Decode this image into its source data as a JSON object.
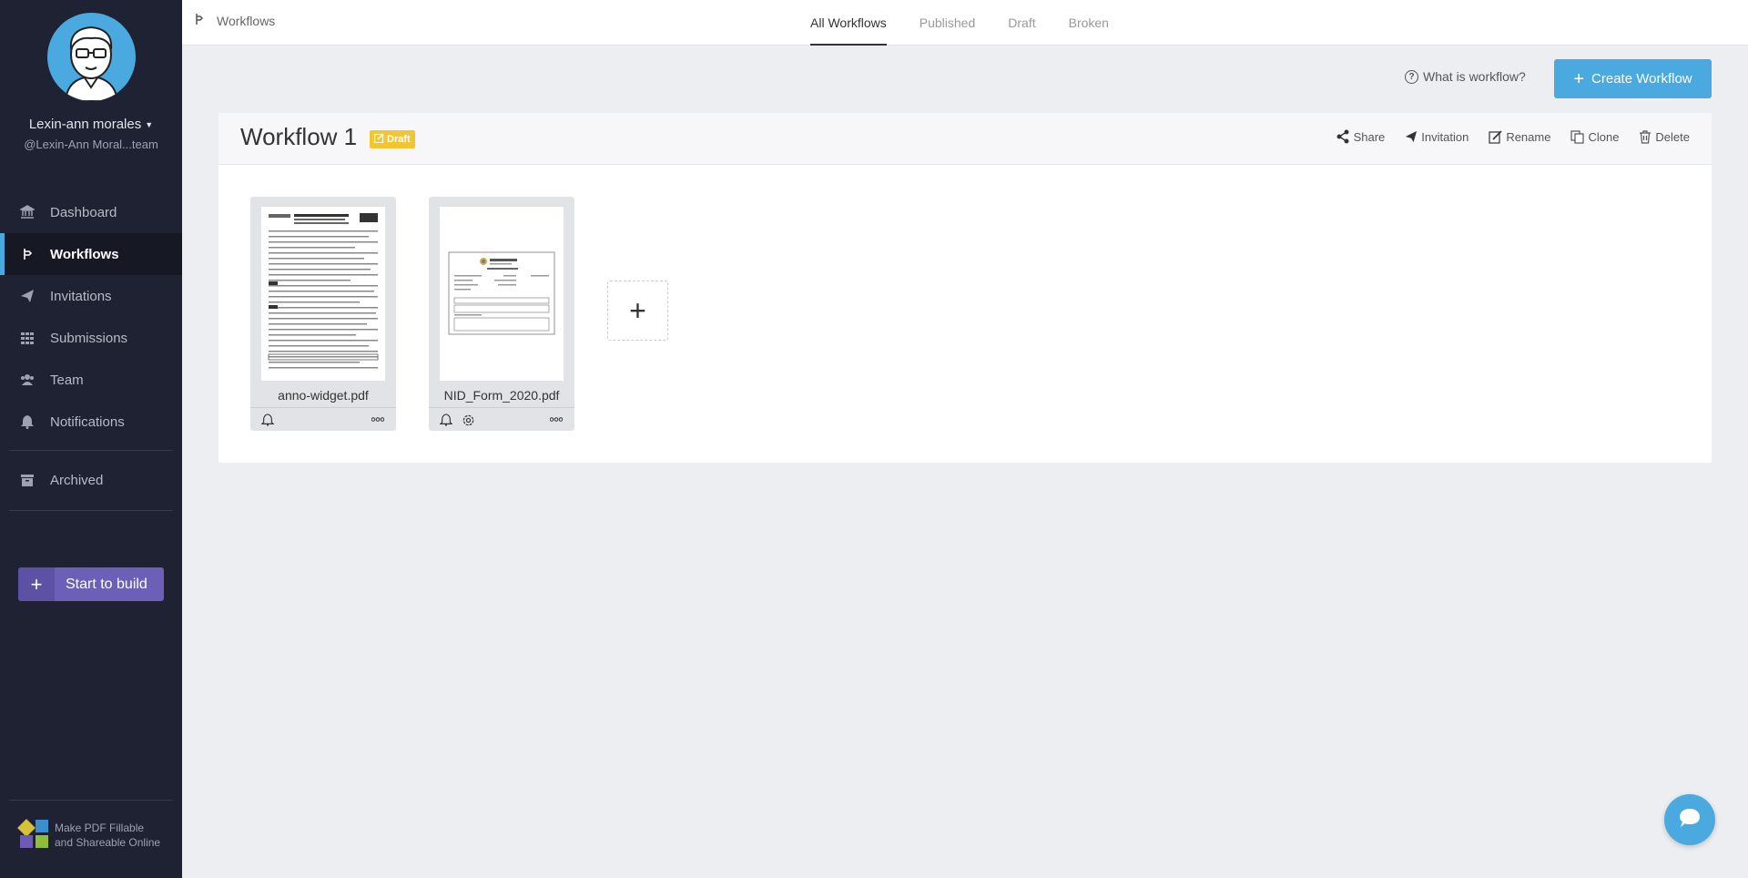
{
  "user": {
    "name": "Lexin-ann morales",
    "handle": "@Lexin-Ann Moral...team"
  },
  "nav": {
    "items": [
      {
        "label": "Dashboard",
        "icon": "bank-icon"
      },
      {
        "label": "Workflows",
        "icon": "workflow-icon",
        "active": true
      },
      {
        "label": "Invitations",
        "icon": "paper-plane-icon"
      },
      {
        "label": "Submissions",
        "icon": "grid-icon"
      },
      {
        "label": "Team",
        "icon": "users-icon"
      },
      {
        "label": "Notifications",
        "icon": "bell-icon"
      }
    ],
    "archived": "Archived"
  },
  "build_button": {
    "label": "Start to build"
  },
  "brand": {
    "line1": "Make PDF Fillable",
    "line2": "and Shareable Online",
    "colors": [
      "#d4c23a",
      "#3a8fcf",
      "#6b5bb5",
      "#8fbf3a"
    ]
  },
  "breadcrumb": {
    "label": "Workflows"
  },
  "tabs": [
    "All Workflows",
    "Published",
    "Draft",
    "Broken"
  ],
  "help_link": "What is workflow?",
  "create_button": "Create Workflow",
  "workflow": {
    "title": "Workflow 1",
    "status": "Draft",
    "actions": [
      "Share",
      "Invitation",
      "Rename",
      "Clone",
      "Delete"
    ],
    "documents": [
      {
        "name": "anno-widget.pdf"
      },
      {
        "name": "NID_Form_2020.pdf"
      }
    ]
  },
  "colors": {
    "accent": "#4aa9de",
    "sidebar": "#1f2232",
    "draft": "#f2c531",
    "build": "#6c5fb8"
  }
}
